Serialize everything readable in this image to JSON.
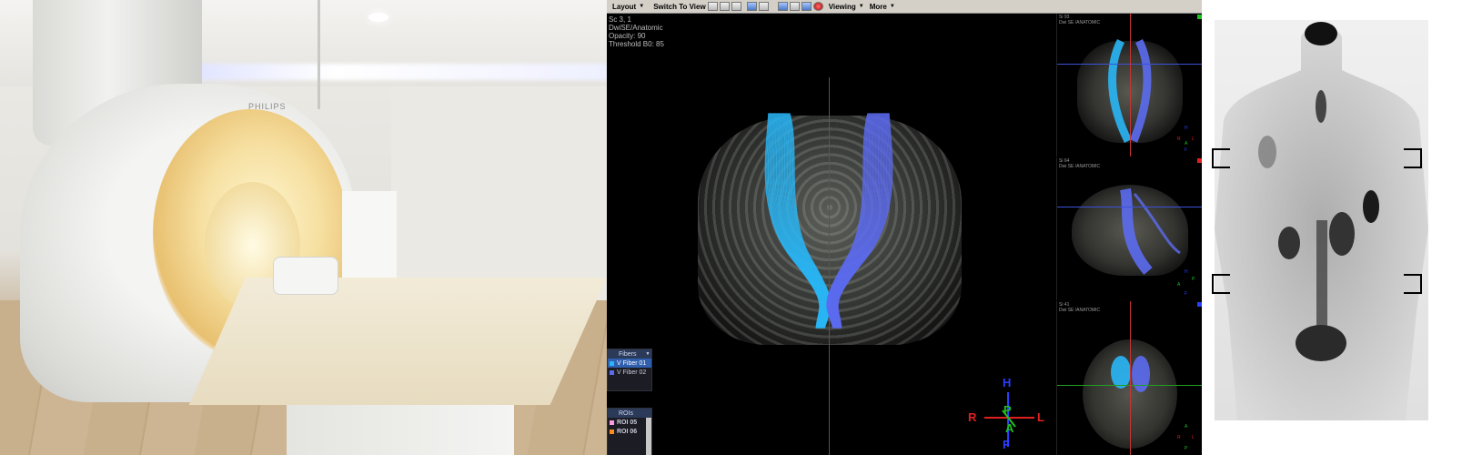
{
  "photo": {
    "brand_text": "PHILIPS"
  },
  "viewer": {
    "toolbar": {
      "layout": "Layout",
      "switch_to_view": "Switch To View",
      "viewing": "Viewing",
      "more": "More"
    },
    "overlay": {
      "line1": "Sc 3, 1",
      "line2": "DwiSE/Anatomic",
      "line3": "Opacity: 90",
      "line4": "Threshold B0: 85"
    },
    "fibers_panel": {
      "title": "Fibers",
      "items": [
        {
          "label": "V Fiber 01",
          "color": "#29b6f6",
          "selected": true
        },
        {
          "label": "V Fiber 02",
          "color": "#5c6bf0",
          "selected": false
        }
      ]
    },
    "rois_panel": {
      "title": "ROIs",
      "items": [
        {
          "label": "ROI 05",
          "color": "#ff9be0"
        },
        {
          "label": "ROI 06",
          "color": "#ff8c1a"
        }
      ]
    },
    "orientation": {
      "top": "H",
      "bottom": "F",
      "left": "R",
      "right": "L",
      "front": "P",
      "back": "A",
      "colors": {
        "H": "#2a3fff",
        "F": "#2a3fff",
        "R": "#e02020",
        "L": "#e02020",
        "P": "#20c020",
        "A": "#20c020"
      }
    },
    "side_views": [
      {
        "label_a": "Si 93",
        "label_b": "Dwi SE /ANATOMIC",
        "marker_color": "#20c020",
        "axes": [
          "H",
          "R",
          "L",
          "A",
          "F"
        ]
      },
      {
        "label_a": "Si 64",
        "label_b": "Dwi SE /ANATOMIC",
        "marker_color": "#e02020",
        "axes": [
          "H",
          "A",
          "P",
          "F"
        ]
      },
      {
        "label_a": "Si 41",
        "label_b": "Dwi SE /ANATOMIC",
        "marker_color": "#2a3fff",
        "axes": [
          "A",
          "R",
          "L",
          "P"
        ]
      }
    ],
    "colors": {
      "fiber_01": "#29b6f6",
      "fiber_02": "#5c6bf0"
    }
  }
}
